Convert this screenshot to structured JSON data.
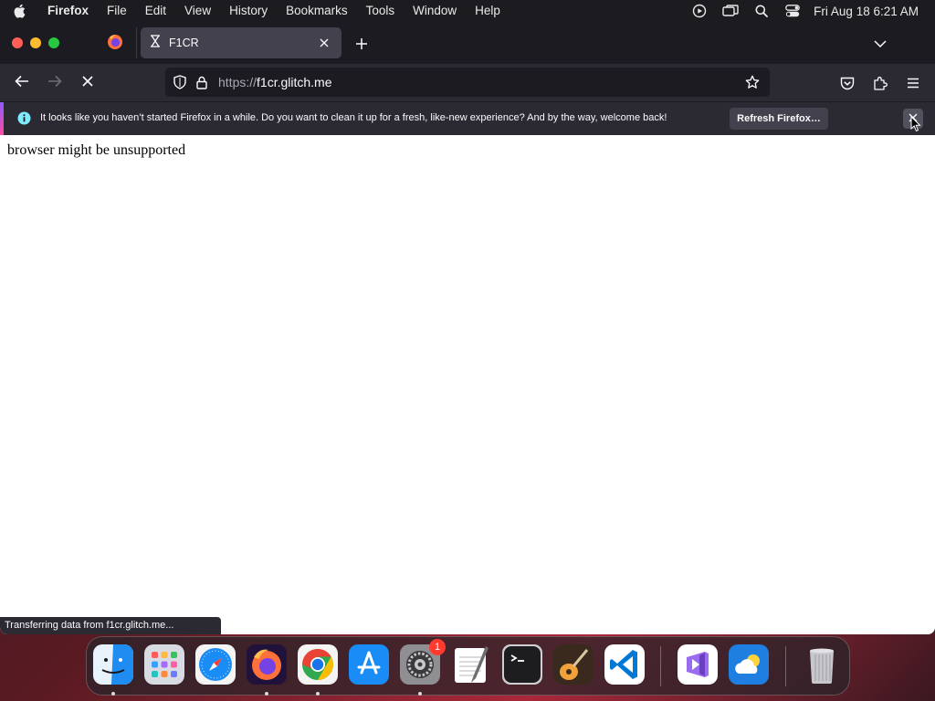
{
  "menubar": {
    "app_name": "Firefox",
    "items": [
      "File",
      "Edit",
      "View",
      "History",
      "Bookmarks",
      "Tools",
      "Window",
      "Help"
    ],
    "clock": "Fri Aug 18  6:21 AM",
    "status_icons": [
      "screen-record-icon",
      "screen-mirroring-icon",
      "spotlight-search-icon",
      "control-center-icon"
    ]
  },
  "tabs": {
    "pinned_icon": "firefox-icon",
    "active_title": "F1CR",
    "active_icon": "loading-hourglass-icon"
  },
  "navbar": {
    "url_prefix": "https://",
    "url_host": "f1cr.glitch.me"
  },
  "notification": {
    "message": "It looks like you haven’t started Firefox in a while. Do you want to clean it up for a fresh, like-new experience? And by the way, welcome back!",
    "button_label": "Refresh Firefox…"
  },
  "page": {
    "body_text": "browser might be unsupported"
  },
  "status": {
    "text": "Transferring data from f1cr.glitch.me..."
  },
  "dock": {
    "apps": [
      "Finder",
      "Launchpad",
      "Safari",
      "Firefox",
      "Google Chrome",
      "App Store",
      "System Settings",
      "TextEdit",
      "Terminal",
      "GarageBand",
      "Visual Studio Code",
      "Visual Studio",
      "Weather",
      "Trash"
    ],
    "settings_badge": "1"
  },
  "colors": {
    "toolbar": "#2b2a33",
    "tabstrip": "#1c1b22",
    "accent_gradient": [
      "#9059ff",
      "#ff4aa2"
    ]
  }
}
